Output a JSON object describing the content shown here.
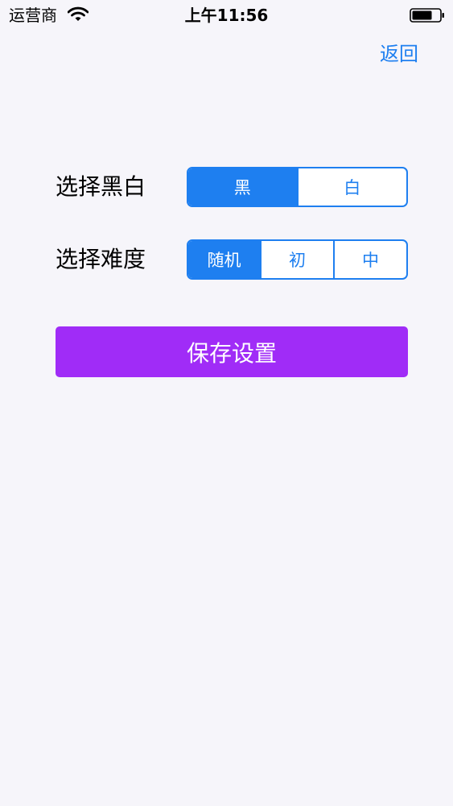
{
  "status_bar": {
    "carrier": "运营商",
    "time": "上午11:56",
    "wifi_icon": "wifi-icon",
    "battery_icon": "battery-icon"
  },
  "nav": {
    "back_label": "返回"
  },
  "color_setting": {
    "label": "选择黑白",
    "options": [
      "黑",
      "白"
    ],
    "selected": "黑"
  },
  "difficulty_setting": {
    "label": "选择难度",
    "options": [
      "随机",
      "初",
      "中"
    ],
    "selected": "随机"
  },
  "save_button": {
    "label": "保存设置",
    "color": "#a02cf7"
  },
  "colors": {
    "accent": "#1e7ff0",
    "background": "#f6f5fa"
  }
}
